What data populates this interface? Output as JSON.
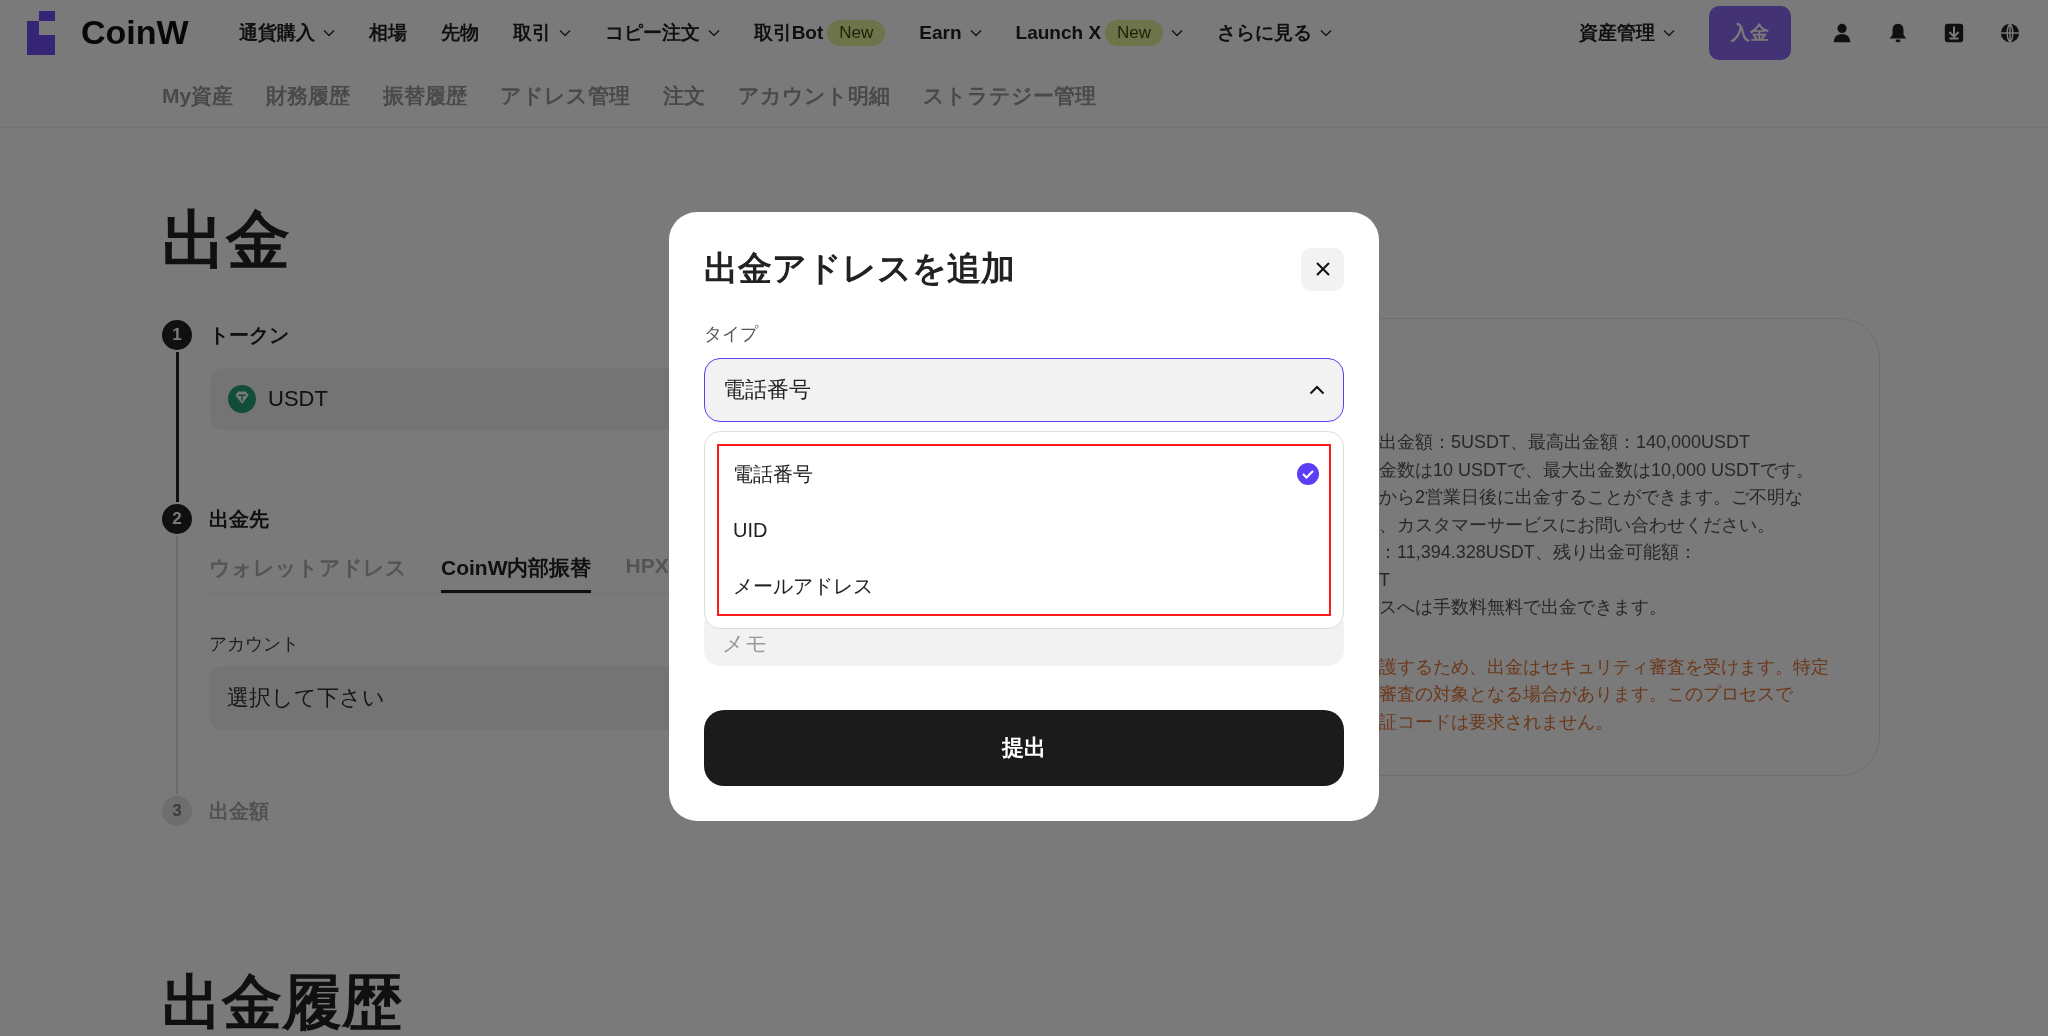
{
  "header": {
    "logo": "CoinW",
    "nav": [
      {
        "label": "通貨購入",
        "has_menu": true
      },
      {
        "label": "相場",
        "has_menu": false
      },
      {
        "label": "先物",
        "has_menu": false
      },
      {
        "label": "取引",
        "has_menu": true
      },
      {
        "label": "コピー注文",
        "has_menu": true
      },
      {
        "label": "取引Bot",
        "has_menu": false,
        "badge": "New"
      },
      {
        "label": "Earn",
        "has_menu": true
      },
      {
        "label": "Launch X",
        "has_menu": true,
        "badge": "New"
      },
      {
        "label": "さらに見る",
        "has_menu": true
      }
    ],
    "assets_menu": "資産管理",
    "deposit_button": "入金"
  },
  "subnav": [
    "My資産",
    "財務履歴",
    "振替履歴",
    "アドレス管理",
    "注文",
    "アカウント明細",
    "ストラテジー管理"
  ],
  "page_title": "出金",
  "steps": [
    {
      "number": "1",
      "label": "トークン",
      "active": true
    },
    {
      "number": "2",
      "label": "出金先",
      "active": true
    },
    {
      "number": "3",
      "label": "出金額",
      "active": false
    }
  ],
  "token_field": {
    "value": "USDT"
  },
  "destination_tabs": [
    {
      "label": "ウォレットアドレス",
      "selected": false
    },
    {
      "label": "CoinW内部振替",
      "selected": true
    },
    {
      "label": "HPX",
      "selected": false
    }
  ],
  "account_field": {
    "label": "アカウント",
    "prompt": "選択して下さい"
  },
  "info_panel": {
    "lines": [
      "出金額：5USDT、最高出金額：140,000USDT",
      "金数は10 USDTで、最大出金数は10,000 USDTです。",
      "から2営業日後に出金することができます。ご不明な",
      "、カスタマーサービスにお問い合わせください。",
      "：11,394.328USDT、残り出金可能額：",
      "T",
      "スへは手数料無料で出金できます。"
    ],
    "warning_lines": [
      "護するため、出金はセキュリティ審査を受けます。特定",
      "審査の対象となる場合があります。このプロセスで",
      "証コードは要求されません。"
    ]
  },
  "history_title": "出金履歴",
  "modal": {
    "title": "出金アドレスを追加",
    "type_label": "タイプ",
    "type_value": "電話番号",
    "expanded": true,
    "options": [
      {
        "label": "電話番号",
        "selected": true
      },
      {
        "label": "UID",
        "selected": false
      },
      {
        "label": "メールアドレス",
        "selected": false
      }
    ],
    "memo_placeholder": "メモ",
    "submit": "提出"
  }
}
